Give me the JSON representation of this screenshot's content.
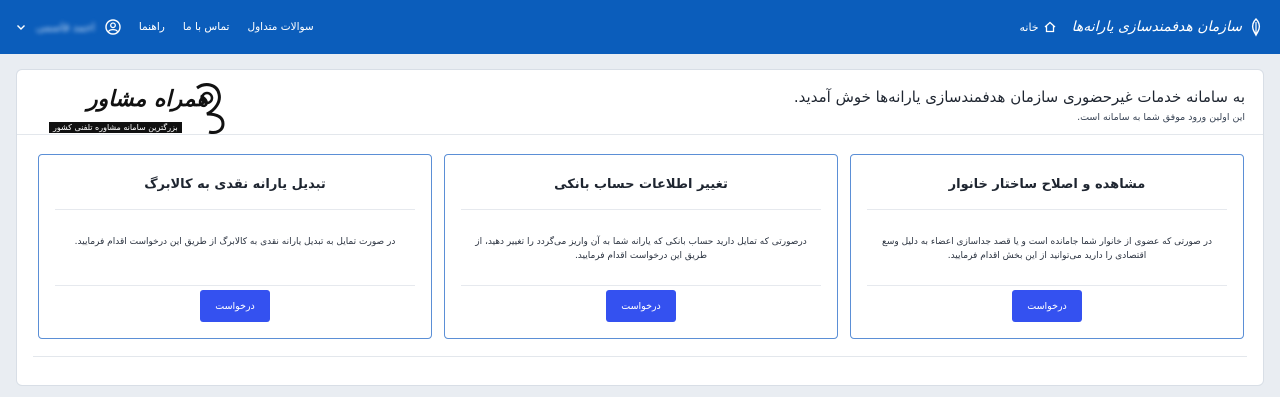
{
  "header": {
    "brand": "سازمان هدفمندسازی یارانه‌ها",
    "home_label": "خانه",
    "user_name": "احمد قاسمی",
    "nav": {
      "help": "راهنما",
      "contact": "تماس با ما",
      "faq": "سوالات متداول"
    }
  },
  "welcome": {
    "title": "به سامانه خدمات غیرحضوری سازمان هدفمندسازی یارانه‌ها خوش آمدید.",
    "subtitle": "این اولین ورود موفق شما به سامانه است."
  },
  "logo": {
    "name": "همراه مشاور",
    "tagline": "بزرگترین سامانه مشاوره تلفنی کشور"
  },
  "cards": [
    {
      "title": "مشاهده و اصلاح ساختار خانوار",
      "description": "در صورتی که عضوی از خانوار شما جامانده است و یا قصد جداسازی اعضاء به دلیل وسع اقتصادی را دارید می‌توانید از این بخش اقدام فرمایید.",
      "button": "درخواست"
    },
    {
      "title": "تغییر اطلاعات حساب بانکی",
      "description": "درصورتی که تمایل دارید حساب بانکی که یارانه شما به آن واریز می‌گردد را تغییر دهید، از طریق این درخواست اقدام فرمایید.",
      "button": "درخواست"
    },
    {
      "title": "تبدیل یارانه نقدی به کالابرگ",
      "description": "در صورت تمایل به تبدیل یارانه نقدی به کالابرگ از طریق این درخواست اقدام فرمایید.",
      "button": "درخواست"
    }
  ],
  "colors": {
    "topbar": "#0b5dbb",
    "primary_button": "#3451f0",
    "card_border": "#5b8fd6"
  }
}
